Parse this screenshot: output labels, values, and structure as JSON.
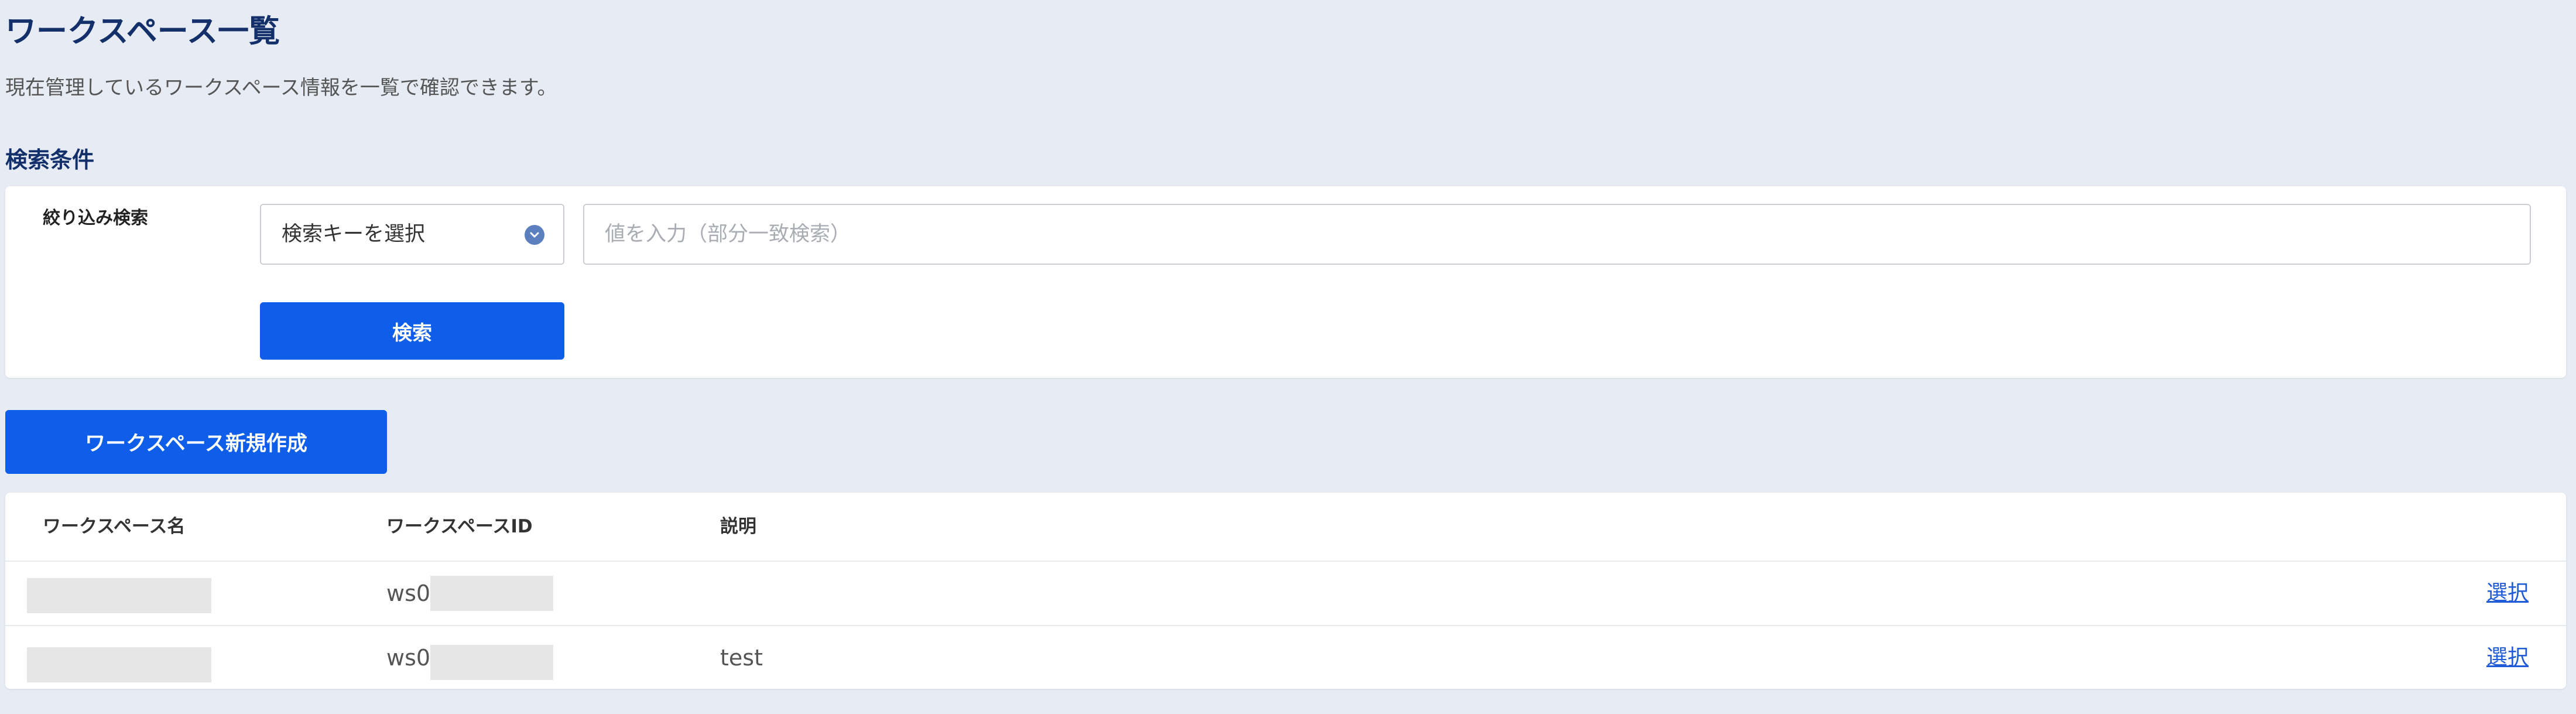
{
  "page": {
    "title": "ワークスペース一覧",
    "description": "現在管理しているワークスペース情報を一覧で確認できます。"
  },
  "search": {
    "heading": "検索条件",
    "filter_label": "絞り込み検索",
    "key_select": {
      "selected": "検索キーを選択",
      "icon": "chevron-down-icon"
    },
    "value_input": {
      "value": "",
      "placeholder": "値を入力（部分一致検索）"
    },
    "search_button_label": "検索"
  },
  "actions": {
    "create_button_label": "ワークスペース新規作成"
  },
  "table": {
    "columns": [
      "ワークスペース名",
      "ワークスペースID",
      "説明"
    ],
    "rows": [
      {
        "name": "",
        "id_prefix": "ws0",
        "description": "",
        "action_label": "選択"
      },
      {
        "name": "",
        "id_prefix": "ws0",
        "description": "test",
        "action_label": "選択"
      }
    ]
  },
  "colors": {
    "background": "#e6ebf4",
    "heading": "#13306b",
    "primary_button": "#0e5ee9",
    "link": "#1f5bd6",
    "redaction": "#e6e6e6"
  }
}
